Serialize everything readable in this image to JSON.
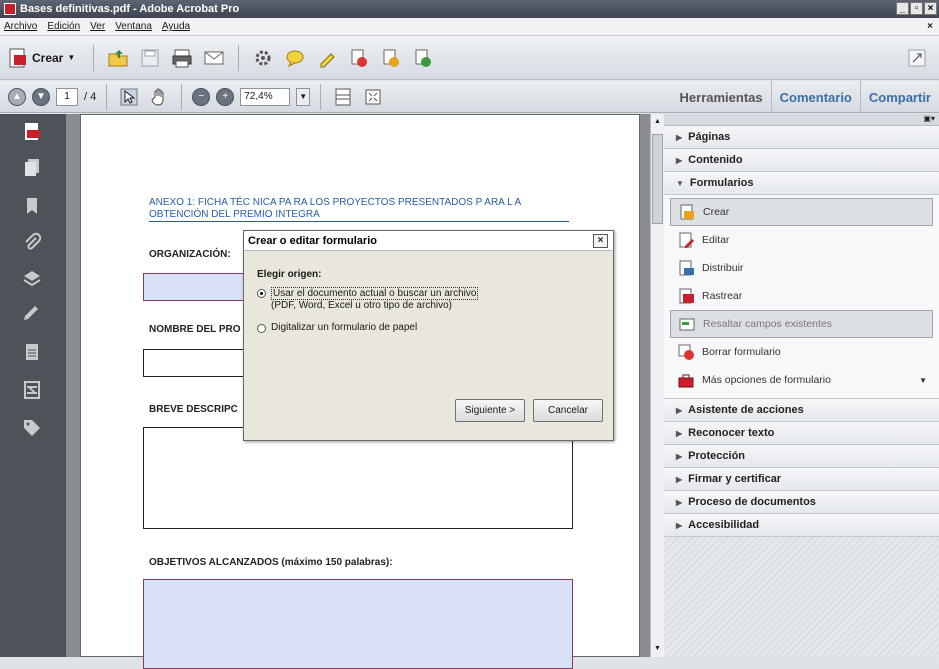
{
  "window": {
    "title": "Bases definitivas.pdf - Adobe Acrobat Pro",
    "controls": [
      "_",
      "▫",
      "×"
    ]
  },
  "menu": {
    "items": [
      "Archivo",
      "Edición",
      "Ver",
      "Ventana",
      "Ayuda"
    ],
    "close_doc": "×"
  },
  "toolbar": {
    "crear_label": "Crear"
  },
  "nav": {
    "page_current": "1",
    "page_total": "/ 4",
    "zoom": "72,4%"
  },
  "panel_tabs": [
    "Herramientas",
    "Comentario",
    "Compartir"
  ],
  "document": {
    "annex_line1": "ANEXO 1: FICHA TÉC NICA PA RA LOS PROYECTOS PRESENTADOS P ARA L A",
    "annex_line2": "OBTENCIÓN DEL  PREMIO INTEGRA",
    "label_org": "ORGANIZACIÓN:",
    "label_nombre": "NOMBRE DEL PRO",
    "label_breve": "BREVE DESCRIPC",
    "label_objetivos": "OBJETIVOS ALCANZADOS (máximo 150 palabras):"
  },
  "right_panel": {
    "sections_top": [
      "Páginas",
      "Contenido",
      "Formularios"
    ],
    "form_items": [
      "Crear",
      "Editar",
      "Distribuir",
      "Rastrear",
      "Resaltar campos existentes",
      "Borrar formulario",
      "Más opciones de formulario"
    ],
    "sections_bottom": [
      "Asistente de acciones",
      "Reconocer texto",
      "Protección",
      "Firmar y certificar",
      "Proceso de documentos",
      "Accesibilidad"
    ]
  },
  "dialog": {
    "title": "Crear o editar formulario",
    "heading": "Elegir origen:",
    "option1_line1": "Usar el documento actual o buscar un archivo",
    "option1_line2": "(PDF, Word, Excel u otro tipo de archivo)",
    "option2": "Digitalizar un formulario de papel",
    "next_button": "Siguiente >",
    "cancel_button": "Cancelar"
  },
  "colors": {
    "accent_blue": "#3a6fa8",
    "field_blue": "#d9e1f7",
    "rail": "#4e5259"
  }
}
